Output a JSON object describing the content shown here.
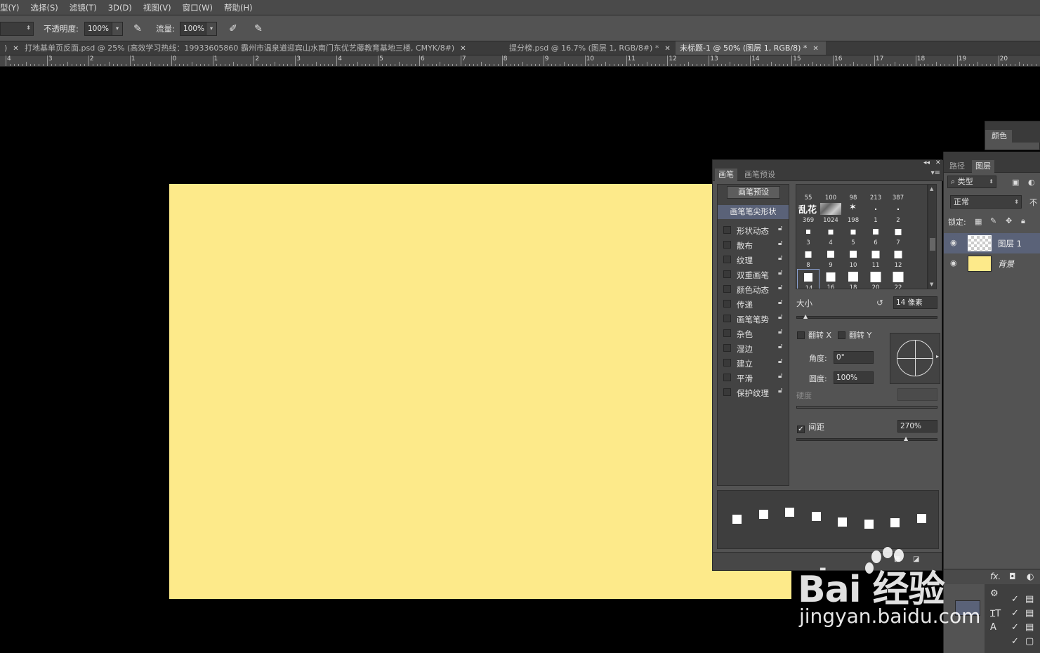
{
  "menu": {
    "items": [
      "型(Y)",
      "选择(S)",
      "滤镜(T)",
      "3D(D)",
      "视图(V)",
      "窗口(W)",
      "帮助(H)"
    ]
  },
  "options": {
    "opacity_label": "不透明度:",
    "opacity_value": "100%",
    "flow_label": "流量:",
    "flow_value": "100%"
  },
  "tabs": [
    {
      "label": "打地基单页反面.psd @ 25% (高效学习热线：19933605860 霸州市温泉道迎宾山水南门东优艺藤教育基地三楼, CMYK/8#)"
    },
    {
      "label": "提分榜.psd @ 16.7% (图层 1, RGB/8#) *"
    },
    {
      "label": "未标题-1 @ 50% (图层 1, RGB/8) *"
    }
  ],
  "ruler": {
    "ticks": [
      "4",
      "3",
      "2",
      "1",
      "0",
      "1",
      "2",
      "3",
      "4",
      "5",
      "6",
      "7",
      "8",
      "9",
      "10",
      "11",
      "12",
      "13",
      "14",
      "15",
      "16",
      "17",
      "18",
      "19",
      "20"
    ]
  },
  "canvas": {
    "fill": "#fdea8a"
  },
  "brush_panel": {
    "tab_brush": "画笔",
    "tab_presets": "画笔预设",
    "preset_button": "画笔预设",
    "tip_shape": "画笔笔尖形状",
    "options": [
      "形状动态",
      "散布",
      "纹理",
      "双重画笔",
      "颜色动态",
      "传递",
      "画笔笔势",
      "杂色",
      "湿边",
      "建立",
      "平滑",
      "保护纹理"
    ],
    "grid": [
      {
        "n": "55",
        "k": "top"
      },
      {
        "n": "100",
        "k": "top"
      },
      {
        "n": "98",
        "k": "top"
      },
      {
        "n": "213",
        "k": "top"
      },
      {
        "n": "387",
        "k": "top"
      },
      {
        "n": "369",
        "k": "luanhua"
      },
      {
        "n": "1024",
        "k": "texture"
      },
      {
        "n": "198",
        "k": "star"
      },
      {
        "n": "1",
        "k": "sq"
      },
      {
        "n": "2",
        "k": "sq"
      },
      {
        "n": "3",
        "k": "sq"
      },
      {
        "n": "4",
        "k": "sq"
      },
      {
        "n": "5",
        "k": "sq"
      },
      {
        "n": "6",
        "k": "sq"
      },
      {
        "n": "7",
        "k": "sq"
      },
      {
        "n": "8",
        "k": "sq"
      },
      {
        "n": "9",
        "k": "sq"
      },
      {
        "n": "10",
        "k": "sq"
      },
      {
        "n": "11",
        "k": "sq"
      },
      {
        "n": "12",
        "k": "sq"
      },
      {
        "n": "14",
        "k": "sq"
      },
      {
        "n": "16",
        "k": "sq"
      },
      {
        "n": "18",
        "k": "sq"
      },
      {
        "n": "20",
        "k": "sq"
      },
      {
        "n": "22",
        "k": "sq"
      }
    ],
    "luanhua_label": "乱花",
    "size_label": "大小",
    "size_value": "14 像素",
    "flip_x": "翻转 X",
    "flip_y": "翻转 Y",
    "angle_label": "角度:",
    "angle_value": "0°",
    "roundness_label": "圆度:",
    "roundness_value": "100%",
    "hardness_label": "硬度",
    "spacing_label": "间距",
    "spacing_value": "270%",
    "spacing_checked": true
  },
  "color_panel": {
    "tab": "颜色"
  },
  "layers_panel": {
    "tab_paths": "路径",
    "tab_layers": "图层",
    "filter_kind": "类型",
    "blend_mode": "正常",
    "opacity_short": "不",
    "lock_label": "锁定:",
    "layers": [
      {
        "name": "图层 1",
        "selected": true,
        "thumb": "transparent"
      },
      {
        "name": "背景",
        "selected": false,
        "thumb": "fill"
      }
    ]
  },
  "watermark": {
    "brand": "Bai  经验",
    "domain": "jingyan.baidu.com"
  }
}
